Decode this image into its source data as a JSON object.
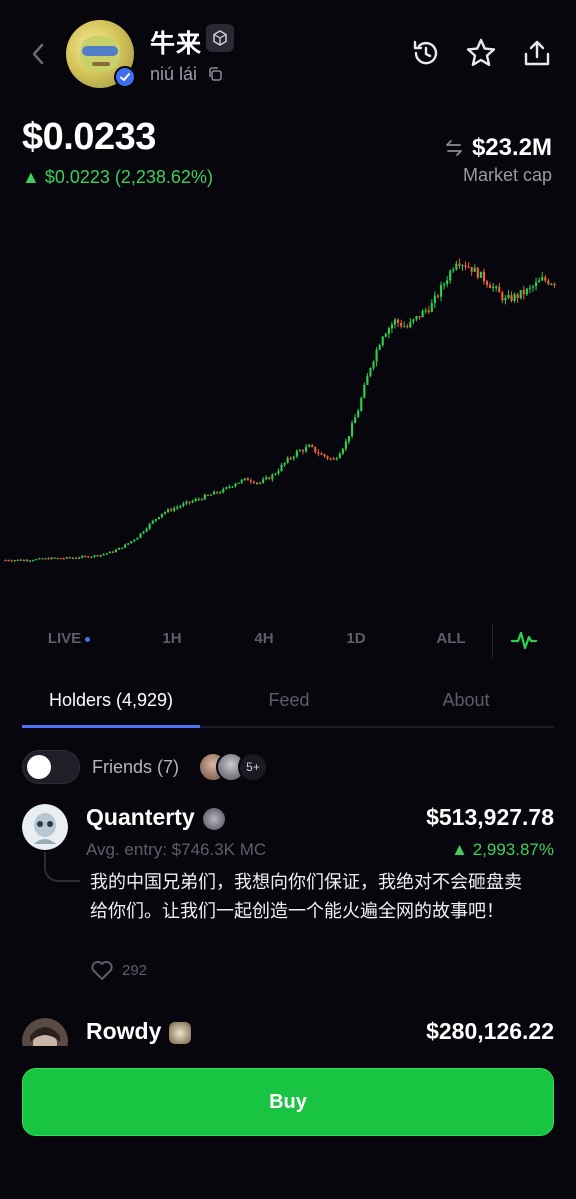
{
  "header": {
    "token_name": "牛来",
    "pinyin": "niú lái",
    "icons": [
      "back-icon",
      "history-icon",
      "star-icon",
      "share-icon",
      "copy-icon",
      "verified-icon",
      "chain-icon"
    ]
  },
  "price": {
    "value": "$0.0233",
    "change": "▲ $0.0223 (2,238.62%)",
    "market_cap_value": "$23.2M",
    "market_cap_label": "Market cap"
  },
  "chart_data": {
    "type": "candlestick",
    "title": "",
    "colors": {
      "up": "#2ecf4e",
      "down": "#f0603a"
    },
    "y_scale": "log",
    "series": [
      {
        "values": [
          0.001,
          0.001,
          0.001,
          0.00101,
          0.00102,
          0.00102,
          0.00103,
          0.00104,
          0.00106,
          0.0011,
          0.00118,
          0.0013,
          0.0015,
          0.0017,
          0.0018,
          0.0019,
          0.002,
          0.0021,
          0.0022,
          0.0024,
          0.0025,
          0.0024,
          0.0026,
          0.003,
          0.0034,
          0.0036,
          0.0033,
          0.0031,
          0.0038,
          0.0055,
          0.009,
          0.013,
          0.015,
          0.014,
          0.016,
          0.018,
          0.023,
          0.03,
          0.028,
          0.025,
          0.022,
          0.019,
          0.02,
          0.0215,
          0.024,
          0.0233
        ]
      }
    ],
    "time_ranges": [
      "LIVE",
      "1H",
      "4H",
      "1D",
      "ALL"
    ],
    "selected_range": "LIVE"
  },
  "tabs": [
    {
      "label": "Holders (4,929)",
      "active": true
    },
    {
      "label": "Feed",
      "active": false
    },
    {
      "label": "About",
      "active": false
    }
  ],
  "friends": {
    "label": "Friends (7)",
    "more": "5+"
  },
  "holders": [
    {
      "name": "Quanterty",
      "value": "$513,927.78",
      "entry": "Avg. entry: $746.3K MC",
      "pnl": "▲ 2,993.87%",
      "comment": "我的中国兄弟们，我想向你们保证，我绝对不会砸盘卖给你们。让我们一起创造一个能火遍全网的故事吧！",
      "likes": "292"
    },
    {
      "name": "Rowdy",
      "value": "$280,126.22"
    }
  ],
  "buy_label": "Buy"
}
